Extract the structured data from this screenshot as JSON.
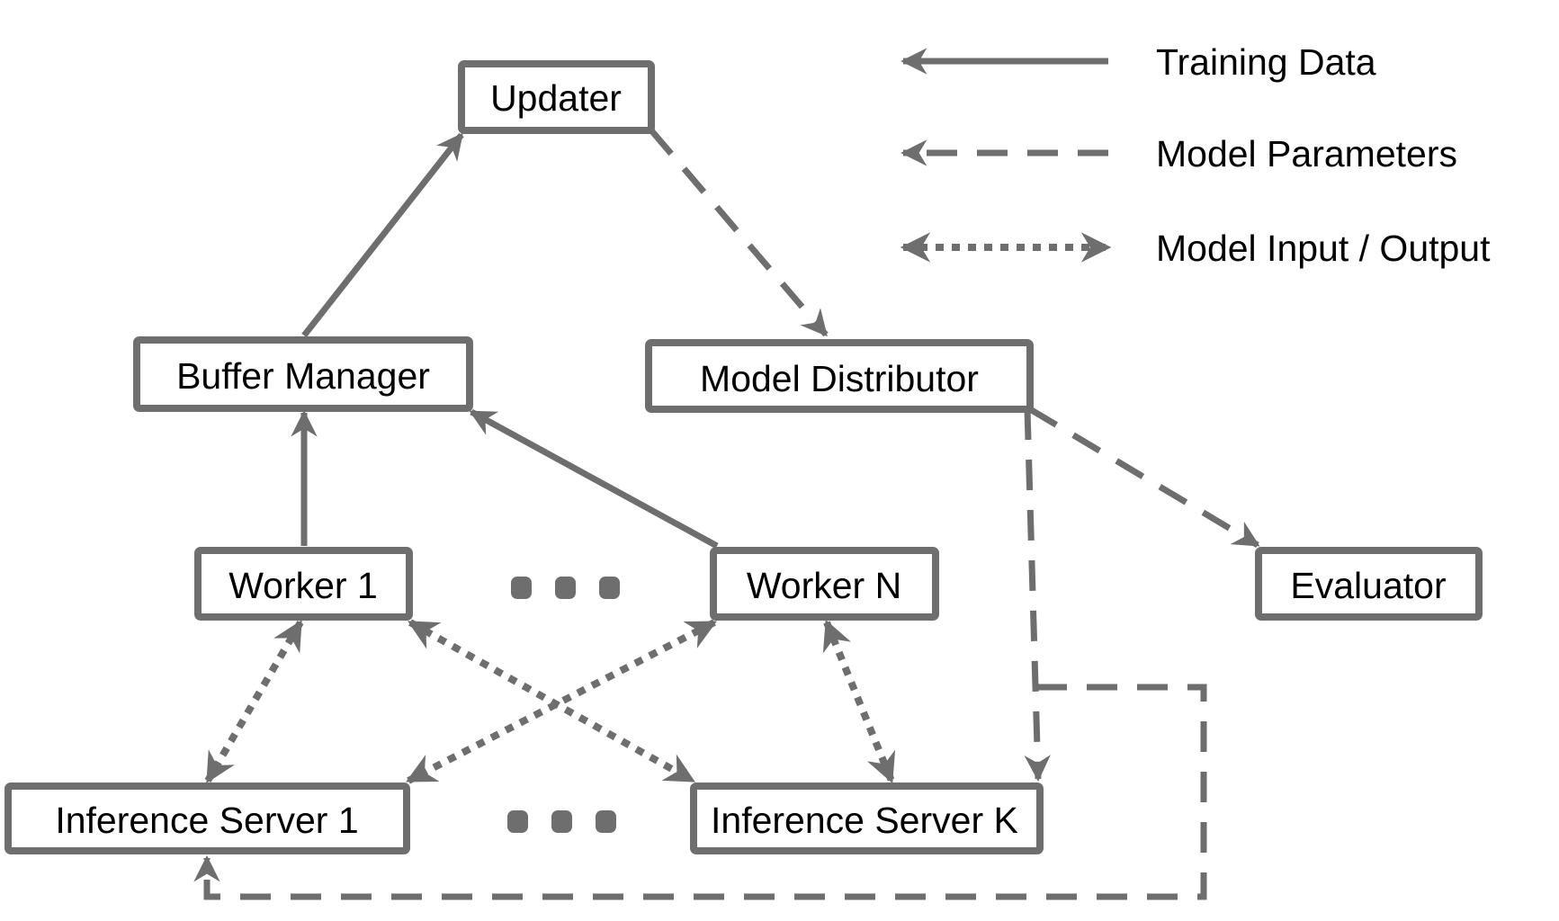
{
  "colors": {
    "stroke": "#6e6e6e",
    "text": "#000000",
    "background": "#ffffff"
  },
  "nodes": {
    "updater": "Updater",
    "buffer_manager": "Buffer Manager",
    "model_distributor": "Model Distributor",
    "worker_1": "Worker 1",
    "worker_n": "Worker N",
    "evaluator": "Evaluator",
    "inference_server_1": "Inference Server 1",
    "inference_server_k": "Inference Server K"
  },
  "legend": {
    "training_data": "Training Data",
    "model_parameters": "Model Parameters",
    "model_io": "Model Input / Output"
  },
  "edges": [
    {
      "from": "buffer_manager",
      "to": "updater",
      "type": "training_data"
    },
    {
      "from": "worker_1",
      "to": "buffer_manager",
      "type": "training_data"
    },
    {
      "from": "worker_n",
      "to": "buffer_manager",
      "type": "training_data"
    },
    {
      "from": "updater",
      "to": "model_distributor",
      "type": "model_parameters"
    },
    {
      "from": "model_distributor",
      "to": "evaluator",
      "type": "model_parameters"
    },
    {
      "from": "model_distributor",
      "to": "inference_server_k",
      "type": "model_parameters"
    },
    {
      "from": "model_distributor",
      "to": "inference_server_1",
      "type": "model_parameters"
    },
    {
      "from": "worker_1",
      "to": "inference_server_1",
      "type": "model_io",
      "bidirectional": true
    },
    {
      "from": "worker_1",
      "to": "inference_server_k",
      "type": "model_io",
      "bidirectional": true
    },
    {
      "from": "worker_n",
      "to": "inference_server_1",
      "type": "model_io",
      "bidirectional": true
    },
    {
      "from": "worker_n",
      "to": "inference_server_k",
      "type": "model_io",
      "bidirectional": true
    }
  ]
}
